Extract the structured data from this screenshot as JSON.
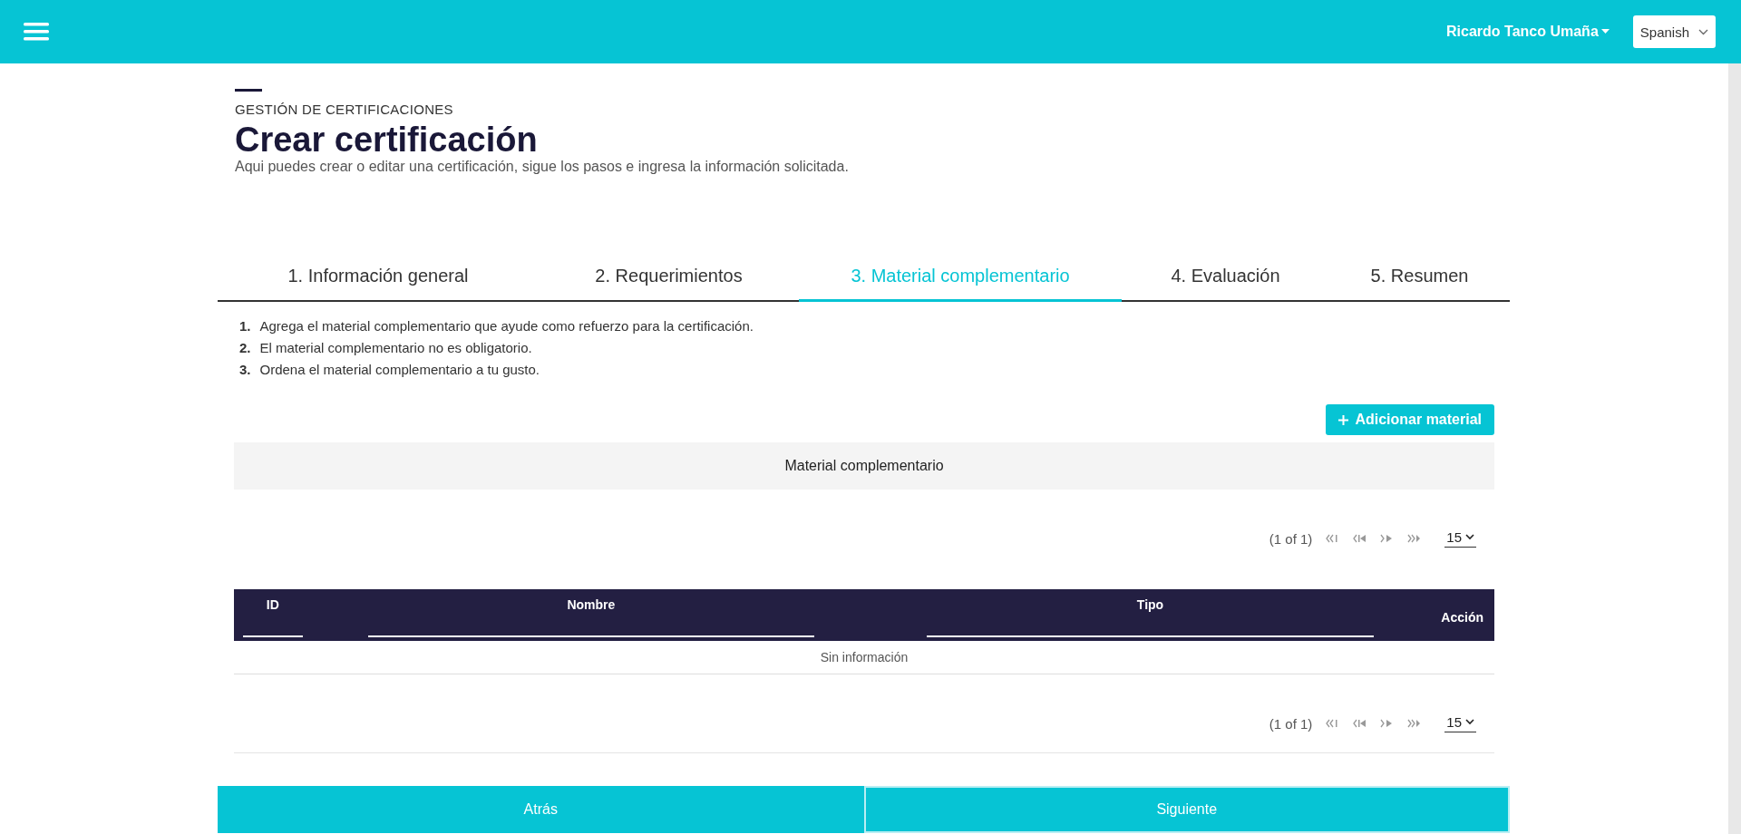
{
  "top_bar": {
    "user": "Ricardo Tanco Umaña",
    "language": "Spanish"
  },
  "header": {
    "section": "GESTIÓN DE CERTIFICACIONES",
    "title": "Crear certificación",
    "description": "Aqui puedes crear o editar una certificación, sigue los pasos e ingresa la información solicitada."
  },
  "tabs": [
    {
      "label": "1. Información general",
      "selected": false
    },
    {
      "label": "2. Requerimientos",
      "selected": false
    },
    {
      "label": "3. Material complementario",
      "selected": true
    },
    {
      "label": "4. Evaluación",
      "selected": false
    },
    {
      "label": "5. Resumen",
      "selected": false
    }
  ],
  "instructions": [
    {
      "number": "1.",
      "text": "Agrega el material complementario que ayude como refuerzo para la certificación."
    },
    {
      "number": "2.",
      "text": "El material complementario no es obligatorio."
    },
    {
      "number": "3.",
      "text": "Ordena el material complementario a tu gusto."
    }
  ],
  "add_button": "Adicionar material",
  "section_title": "Material complementario",
  "pagination_top": {
    "page": "(1 of 1)",
    "page_size": "15"
  },
  "table": {
    "columns": [
      {
        "label": "ID",
        "kind": "filter"
      },
      {
        "label": "Nombre",
        "kind": "filter"
      },
      {
        "label": "Tipo",
        "kind": "filter"
      },
      {
        "label": "Acción",
        "kind": "plain"
      }
    ],
    "empty": "Sin información"
  },
  "pagination_bottom": {
    "page": "(1 of 1)",
    "page_size": "15"
  },
  "buttons": [
    {
      "label": "Atrás",
      "selected": false
    },
    {
      "label": "Siguiente",
      "selected": true
    }
  ]
}
